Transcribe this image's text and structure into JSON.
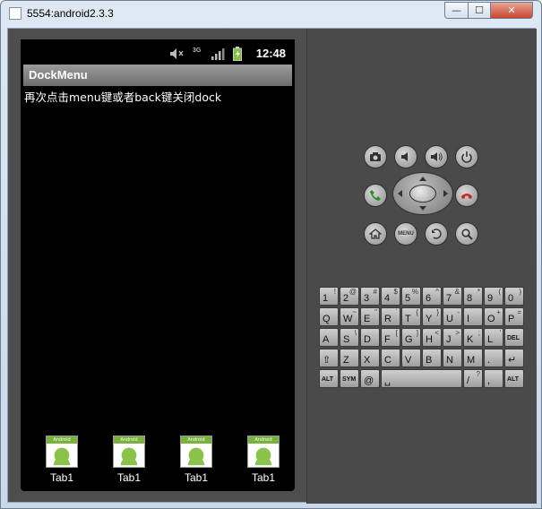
{
  "window": {
    "title": "5554:android2.3.3",
    "controls": {
      "minimize": "—",
      "maximize": "☐",
      "close": "✕"
    }
  },
  "status_bar": {
    "time": "12:48",
    "network": "3G"
  },
  "app": {
    "title": "DockMenu",
    "message": "再次点击menu键或者back键关闭dock"
  },
  "dock": {
    "tabs": [
      {
        "label": "Tab1",
        "icon_text": "Android"
      },
      {
        "label": "Tab1",
        "icon_text": "Android"
      },
      {
        "label": "Tab1",
        "icon_text": "Android"
      },
      {
        "label": "Tab1",
        "icon_text": "Android"
      }
    ]
  },
  "hardware_buttons": {
    "menu": "MENU"
  },
  "keyboard": {
    "row1": [
      {
        "main": "1",
        "sub": "!"
      },
      {
        "main": "2",
        "sub": "@"
      },
      {
        "main": "3",
        "sub": "#"
      },
      {
        "main": "4",
        "sub": "$"
      },
      {
        "main": "5",
        "sub": "%"
      },
      {
        "main": "6",
        "sub": "^"
      },
      {
        "main": "7",
        "sub": "&"
      },
      {
        "main": "8",
        "sub": "*"
      },
      {
        "main": "9",
        "sub": "("
      },
      {
        "main": "0",
        "sub": ")"
      }
    ],
    "row2": [
      {
        "main": "Q",
        "sub": ""
      },
      {
        "main": "W",
        "sub": "~"
      },
      {
        "main": "E",
        "sub": "\""
      },
      {
        "main": "R",
        "sub": "`"
      },
      {
        "main": "T",
        "sub": "{"
      },
      {
        "main": "Y",
        "sub": "}"
      },
      {
        "main": "U",
        "sub": "-"
      },
      {
        "main": "I",
        "sub": ""
      },
      {
        "main": "O",
        "sub": "+"
      },
      {
        "main": "P",
        "sub": "="
      }
    ],
    "row3": [
      {
        "main": "A",
        "sub": ""
      },
      {
        "main": "S",
        "sub": "\\"
      },
      {
        "main": "D",
        "sub": ""
      },
      {
        "main": "F",
        "sub": "["
      },
      {
        "main": "G",
        "sub": "]"
      },
      {
        "main": "H",
        "sub": "<"
      },
      {
        "main": "J",
        "sub": ">"
      },
      {
        "main": "K",
        "sub": ";"
      },
      {
        "main": "L",
        "sub": "'"
      },
      {
        "main": "DEL",
        "sub": ""
      }
    ],
    "row4": [
      {
        "main": "⇧",
        "sub": ""
      },
      {
        "main": "Z",
        "sub": ""
      },
      {
        "main": "X",
        "sub": ""
      },
      {
        "main": "C",
        "sub": ""
      },
      {
        "main": "V",
        "sub": ""
      },
      {
        "main": "B",
        "sub": ""
      },
      {
        "main": "N",
        "sub": ""
      },
      {
        "main": "M",
        "sub": ""
      },
      {
        "main": ".",
        "sub": ""
      },
      {
        "main": "↵",
        "sub": ""
      }
    ],
    "row5": [
      {
        "main": "ALT",
        "sub": ""
      },
      {
        "main": "SYM",
        "sub": ""
      },
      {
        "main": "@",
        "sub": ""
      },
      {
        "main": "␣",
        "sub": ""
      },
      {
        "main": "/",
        "sub": "?"
      },
      {
        "main": ",",
        "sub": ""
      },
      {
        "main": "ALT",
        "sub": ""
      }
    ]
  }
}
